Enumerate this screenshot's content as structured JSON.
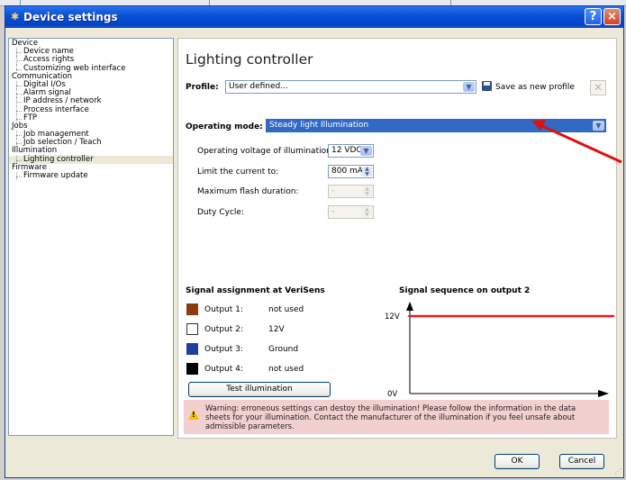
{
  "window": {
    "title": "Device settings",
    "app_icon": "app-icon"
  },
  "titlebar_buttons": {
    "help": "?",
    "close": "×"
  },
  "tree": [
    {
      "label": "Device",
      "level": 0
    },
    {
      "label": "Device name",
      "level": 1
    },
    {
      "label": "Access rights",
      "level": 1
    },
    {
      "label": "Customizing web interface",
      "level": 1
    },
    {
      "label": "Communication",
      "level": 0
    },
    {
      "label": "Digital I/Os",
      "level": 1
    },
    {
      "label": "Alarm signal",
      "level": 1
    },
    {
      "label": "IP address / network",
      "level": 1
    },
    {
      "label": "Process interface",
      "level": 1
    },
    {
      "label": "FTP",
      "level": 1
    },
    {
      "label": "Jobs",
      "level": 0
    },
    {
      "label": "Job management",
      "level": 1
    },
    {
      "label": "Job selection / Teach",
      "level": 1
    },
    {
      "label": "Illumination",
      "level": 0
    },
    {
      "label": "Lighting controller",
      "level": 1,
      "selected": true
    },
    {
      "label": "Firmware",
      "level": 0
    },
    {
      "label": "Firmware update",
      "level": 1
    }
  ],
  "panel": {
    "title": "Lighting controller",
    "profile_label": "Profile:",
    "profile_value": "User defined...",
    "save_profile_label": "Save as new profile",
    "operating_mode_label": "Operating mode:",
    "operating_mode_value": "Steady light Illumination",
    "settings": {
      "voltage_label": "Operating voltage of illumination:",
      "voltage_value": "12 VDC",
      "current_label": "Limit the current to:",
      "current_value": "800 mA",
      "flash_label": "Maximum flash duration:",
      "flash_value": "-",
      "duty_label": "Duty Cycle:",
      "duty_value": "-"
    },
    "signal_assignment": {
      "title": "Signal assignment at VeriSens",
      "outputs": [
        {
          "name": "Output 1:",
          "value": "not used",
          "color": "#8b3a12"
        },
        {
          "name": "Output 2:",
          "value": "12V",
          "color": "#ffffff"
        },
        {
          "name": "Output 3:",
          "value": "Ground",
          "color": "#1f3fa0"
        },
        {
          "name": "Output 4:",
          "value": "not used",
          "color": "#000000"
        }
      ]
    },
    "signal_sequence": {
      "title": "Signal sequence on output 2",
      "y_high": "12V",
      "y_low": "0V",
      "level": "high",
      "line_color": "#e41c1c"
    },
    "test_button": "Test illumination",
    "warning": "Warning:  erroneous settings can destoy the illumination! Please follow the information in the data sheets for your illumination. Contact the manufacturer of the illumination if you feel unsafe about admissible parameters."
  },
  "footer": {
    "ok": "OK",
    "cancel": "Cancel"
  },
  "annotation": {
    "arrow_color": "#e01010"
  }
}
